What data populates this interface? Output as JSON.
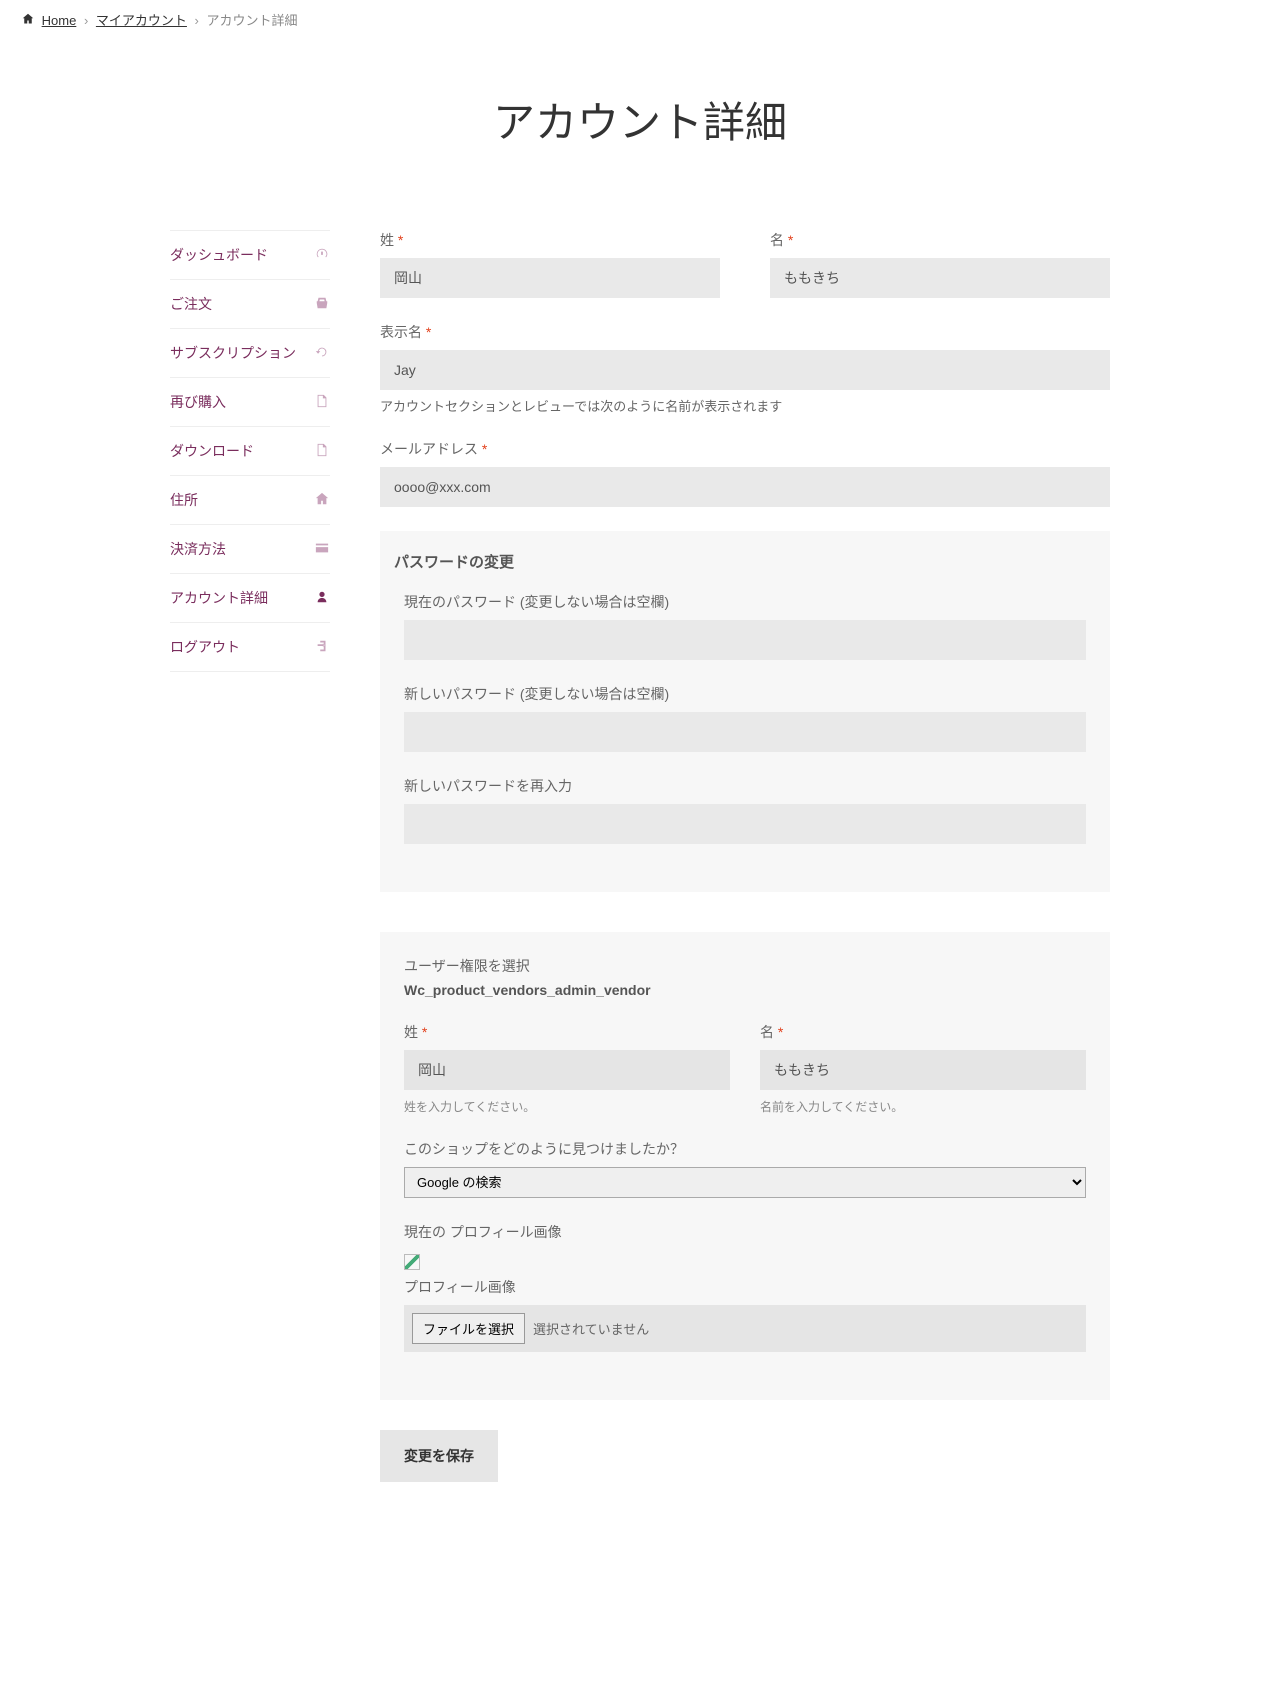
{
  "breadcrumb": {
    "home": "Home",
    "my_account": "マイアカウント",
    "current": "アカウント詳細"
  },
  "page_title": "アカウント詳細",
  "sidebar": {
    "items": [
      {
        "label": "ダッシュボード",
        "icon": "dashboard"
      },
      {
        "label": "ご注文",
        "icon": "basket"
      },
      {
        "label": "サブスクリプション",
        "icon": "refresh"
      },
      {
        "label": "再び購入",
        "icon": "file"
      },
      {
        "label": "ダウンロード",
        "icon": "file"
      },
      {
        "label": "住所",
        "icon": "home"
      },
      {
        "label": "決済方法",
        "icon": "card"
      },
      {
        "label": "アカウント詳細",
        "icon": "user",
        "active": true
      },
      {
        "label": "ログアウト",
        "icon": "logout"
      }
    ]
  },
  "form": {
    "last_name_label": "姓",
    "last_name": "岡山",
    "first_name_label": "名",
    "first_name": "ももきち",
    "display_name_label": "表示名",
    "display_name": "Jay",
    "display_name_help": "アカウントセクションとレビューでは次のように名前が表示されます",
    "email_label": "メールアドレス",
    "email": "oooo@xxx.com",
    "password_legend": "パスワードの変更",
    "current_pw_label": "現在のパスワード (変更しない場合は空欄)",
    "new_pw_label": "新しいパスワード (変更しない場合は空欄)",
    "confirm_pw_label": "新しいパスワードを再入力"
  },
  "extra": {
    "role_label": "ユーザー権限を選択",
    "role_value": "Wc_product_vendors_admin_vendor",
    "last_name_label": "姓",
    "last_name": "岡山",
    "last_name_help": "姓を入力してください。",
    "first_name_label": "名",
    "first_name": "ももきち",
    "first_name_help": "名前を入力してください。",
    "found_label": "このショップをどのように見つけましたか？",
    "found_value": "Google の検索",
    "current_image_label": "現在の プロフィール画像",
    "image_label": "プロフィール画像",
    "file_btn": "ファイルを選択",
    "file_status": "選択されていません"
  },
  "submit": "変更を保存"
}
